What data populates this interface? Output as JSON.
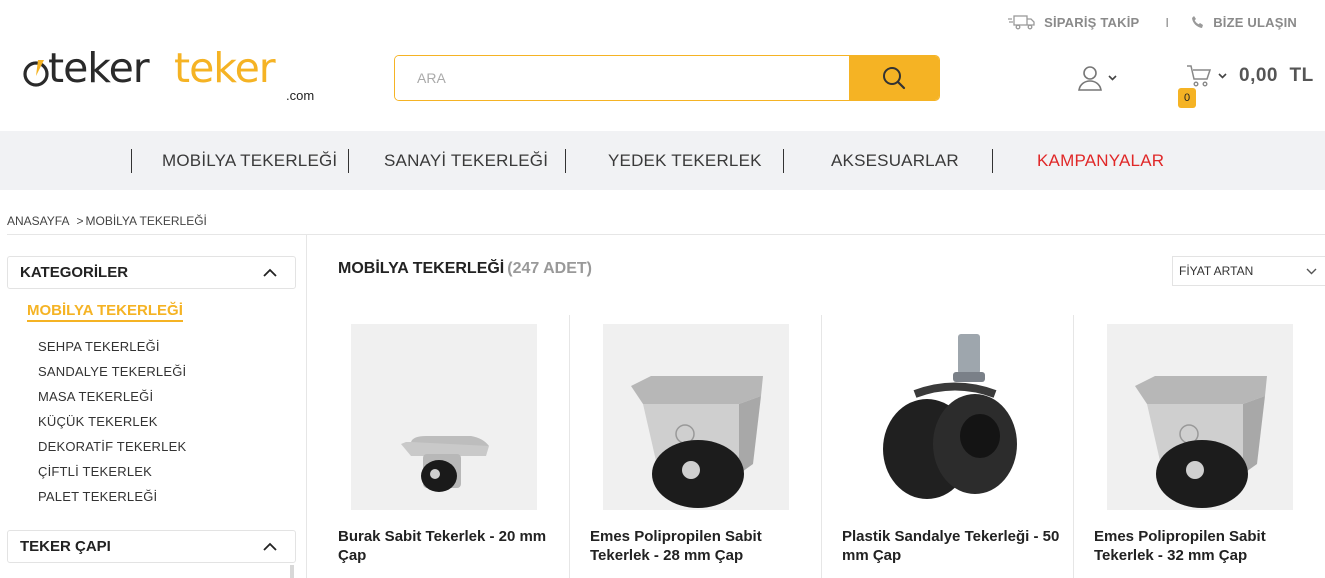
{
  "topbar": {
    "track_label": "SİPARİŞ TAKİP",
    "separator": "I",
    "contact_label": "BİZE ULAŞIN"
  },
  "brand": {
    "part1": "teker",
    "part2": "teker",
    "suffix": ".com"
  },
  "search": {
    "placeholder": "ARA",
    "value": ""
  },
  "cart": {
    "amount": "0,00",
    "currency": "TL",
    "count": "0"
  },
  "nav": [
    {
      "label": "MOBİLYA TEKERLEĞİ"
    },
    {
      "label": "SANAYİ TEKERLEĞİ"
    },
    {
      "label": "YEDEK TEKERLEK"
    },
    {
      "label": "AKSESUARLAR"
    },
    {
      "label": "KAMPANYALAR"
    }
  ],
  "breadcrumb": {
    "home": "ANASAYFA",
    "sep": ">",
    "current": "MOBİLYA TEKERLEĞİ"
  },
  "sidebar": {
    "categories_title": "KATEGORİLER",
    "active_category": "MOBİLYA TEKERLEĞİ",
    "subcategories": [
      "SEHPA TEKERLEĞİ",
      "SANDALYE TEKERLEĞİ",
      "MASA TEKERLEĞİ",
      "KÜÇÜK TEKERLEK",
      "DEKORATİF TEKERLEK",
      "ÇİFTLİ TEKERLEK",
      "PALET TEKERLEĞİ"
    ],
    "diameter_title": "TEKER ÇAPI"
  },
  "listing": {
    "title": "MOBİLYA TEKERLEĞİ",
    "count": "(247 ADET)",
    "sort_value": "FİYAT ARTAN"
  },
  "products": [
    {
      "title": "Burak Sabit Tekerlek - 20 mm Çap"
    },
    {
      "title": "Emes Polipropilen Sabit Tekerlek - 28 mm Çap"
    },
    {
      "title": "Plastik Sandalye Tekerleği - 50 mm Çap"
    },
    {
      "title": "Emes Polipropilen Sabit Tekerlek - 32 mm Çap"
    }
  ],
  "colors": {
    "accent": "#f5b324",
    "campaign": "#e02828",
    "nav_bg": "#f1f2f4"
  }
}
